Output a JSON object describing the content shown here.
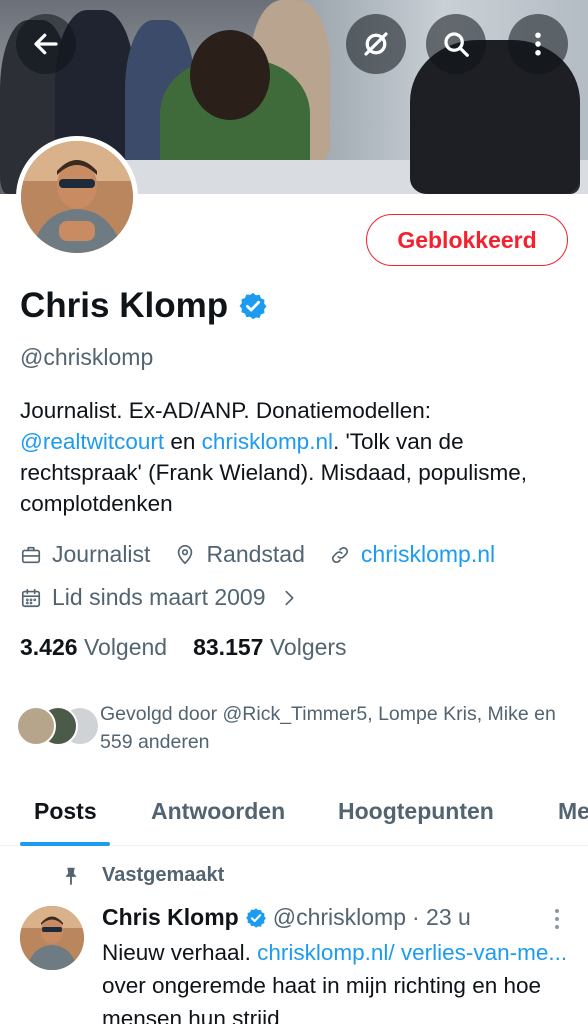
{
  "header": {
    "back_icon": "arrow-left-icon",
    "mute_icon": "mute-off-icon",
    "search_icon": "search-icon",
    "more_icon": "more-vertical-icon"
  },
  "profile": {
    "name": "Chris Klomp",
    "handle": "@chrisklomp",
    "blocked_label": "Geblokkeerd",
    "bio": {
      "part1": "Journalist. Ex-AD/ANP. Donatiemodellen: ",
      "mention": "@realtwitcourt",
      "part2": " en ",
      "link": "chrisklomp.nl",
      "part3": ". 'Tolk van de rechtspraak' (Frank Wieland). Misdaad, populisme, complotdenken"
    },
    "profession": "Journalist",
    "location": "Randstad",
    "website": "chrisklomp.nl",
    "joined": "Lid sinds maart 2009",
    "following_count": "3.426",
    "following_label": "Volgend",
    "followers_count": "83.157",
    "followers_label": "Volgers",
    "followed_by": "Gevolgd door @Rick_Timmer5, Lompe Kris, Mike en 559 anderen"
  },
  "tabs": [
    "Posts",
    "Antwoorden",
    "Hoogtepunten",
    "Me"
  ],
  "active_tab": "Posts",
  "post": {
    "pinned_label": "Vastgemaakt",
    "author": "Chris Klomp",
    "handle": "@chrisklomp",
    "time": "· 23 u",
    "text_start": "Nieuw verhaal. ",
    "link": "chrisklomp.nl/ verlies-van-me...",
    "text_end": " over ongeremde haat in mijn richting en hoe mensen hun strijd"
  },
  "colors": {
    "accent": "#1d9bf0",
    "blocked": "#f4212e",
    "secondary_text": "#536471"
  }
}
